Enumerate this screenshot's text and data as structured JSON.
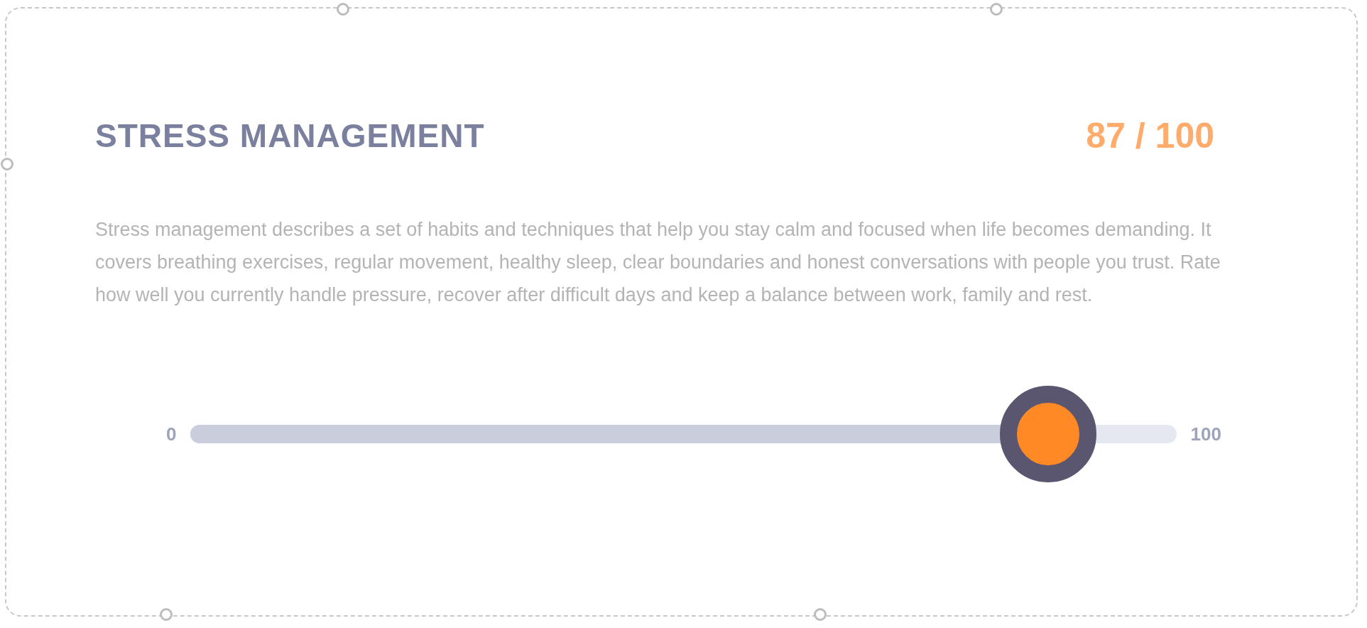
{
  "card": {
    "title": "STRESS MANAGEMENT",
    "score": "87 / 100",
    "description": "Stress management describes a set of habits and techniques that help you stay calm and focused when life becomes demanding. It covers breathing exercises, regular movement, healthy sleep, clear boundaries and honest conversations with people you trust. Rate how well you currently handle pressure, recover after difficult days and keep a balance between work, family and rest.",
    "slider": {
      "min_label": "0",
      "max_label": "100",
      "level": 0.87
    }
  }
}
